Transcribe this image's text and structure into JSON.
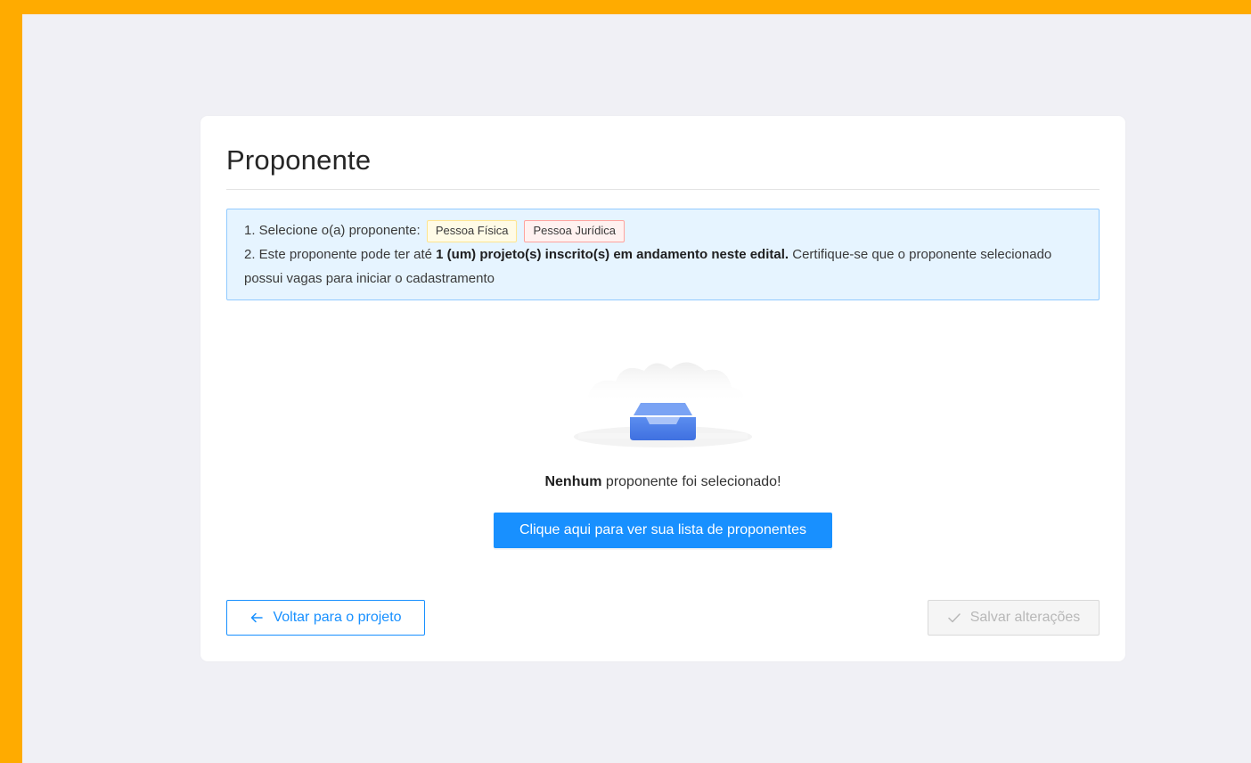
{
  "page": {
    "title": "Proponente"
  },
  "alert": {
    "line1_prefix": "1. Selecione o(a) proponente:",
    "tag_fisica": "Pessoa Física",
    "tag_juridica": "Pessoa Jurídica",
    "line2_prefix": "2. Este proponente pode ter até ",
    "line2_bold": "1 (um) projeto(s) inscrito(s) em andamento neste edital.",
    "line2_suffix": " Certifique-se que o proponente selecionado possui vagas para iniciar o cadastramento"
  },
  "empty": {
    "bold": "Nenhum",
    "text": " proponente foi selecionado!",
    "button_label": "Clique aqui para ver sua lista de proponentes",
    "icon": "empty-inbox-icon"
  },
  "footer": {
    "back_label": "Voltar para o projeto",
    "back_icon": "arrow-left-icon",
    "save_label": "Salvar alterações",
    "save_icon": "check-icon"
  },
  "colors": {
    "frame": "#ffab00",
    "primary": "#1890ff",
    "alert_bg": "#e6f4ff",
    "alert_border": "#91caff"
  }
}
